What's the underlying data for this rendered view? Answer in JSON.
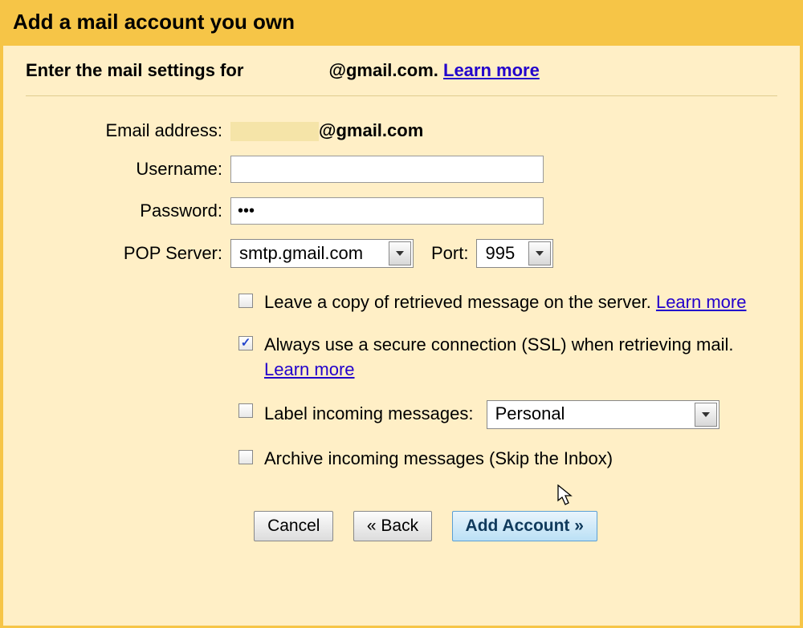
{
  "title": "Add a mail account you own",
  "subtitle_prefix": "Enter the mail settings for ",
  "subtitle_email_domain": "@gmail.com.",
  "learn_more": "Learn more",
  "fields": {
    "email_label": "Email address:",
    "email_domain": "@gmail.com",
    "username_label": "Username:",
    "username_value": "",
    "password_label": "Password:",
    "password_value": "•••",
    "pop_server_label": "POP Server:",
    "pop_server_value": "smtp.gmail.com",
    "port_label": "Port:",
    "port_value": "995"
  },
  "options": {
    "leave_copy": {
      "checked": false,
      "label": "Leave a copy of retrieved message on the server. "
    },
    "ssl": {
      "checked": true,
      "label": "Always use a secure connection (SSL) when retrieving mail. "
    },
    "label_incoming": {
      "checked": false,
      "label": "Label incoming messages:",
      "select_value": "Personal"
    },
    "archive": {
      "checked": false,
      "label": "Archive incoming messages (Skip the Inbox)"
    }
  },
  "buttons": {
    "cancel": "Cancel",
    "back": "« Back",
    "add": "Add Account »"
  }
}
